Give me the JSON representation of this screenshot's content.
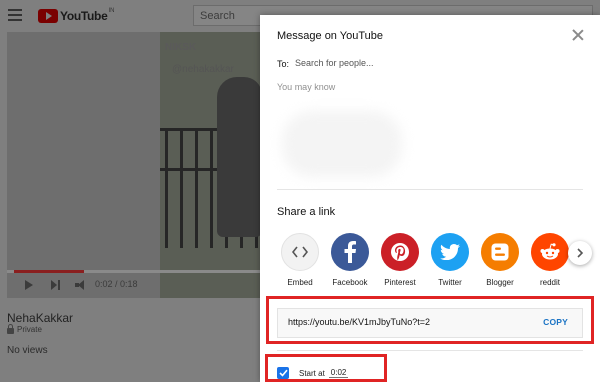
{
  "header": {
    "logo_text": "YouTube",
    "logo_region": "IN",
    "search_placeholder": "Search"
  },
  "player": {
    "video_watermark": "NIKSK",
    "video_handle": "@nehakakkar",
    "time_display": "0:02 / 0:18",
    "progress_fraction": 0.11
  },
  "video_info": {
    "channel": "NehaKakkar",
    "privacy": "Private",
    "views": "No views"
  },
  "dialog": {
    "title": "Message on YouTube",
    "to_label": "To:",
    "to_placeholder": "Search for people...",
    "may_know": "You may know",
    "share_heading": "Share a link",
    "share_targets": [
      {
        "name": "Embed",
        "icon": "embed-icon",
        "color": "#f2f2f2"
      },
      {
        "name": "Facebook",
        "icon": "facebook-icon",
        "color": "#3b5998"
      },
      {
        "name": "Pinterest",
        "icon": "pinterest-icon",
        "color": "#cb2027"
      },
      {
        "name": "Twitter",
        "icon": "twitter-icon",
        "color": "#1da1f2"
      },
      {
        "name": "Blogger",
        "icon": "blogger-icon",
        "color": "#f57d00"
      },
      {
        "name": "reddit",
        "icon": "reddit-icon",
        "color": "#ff4500"
      }
    ],
    "link_url": "https://youtu.be/KV1mJbyTuNo?t=2",
    "copy_label": "COPY",
    "start_label": "Start at",
    "start_time": "0:02",
    "start_checked": true
  },
  "colors": {
    "accent": "#1a73c4",
    "highlight": "#e02424"
  }
}
